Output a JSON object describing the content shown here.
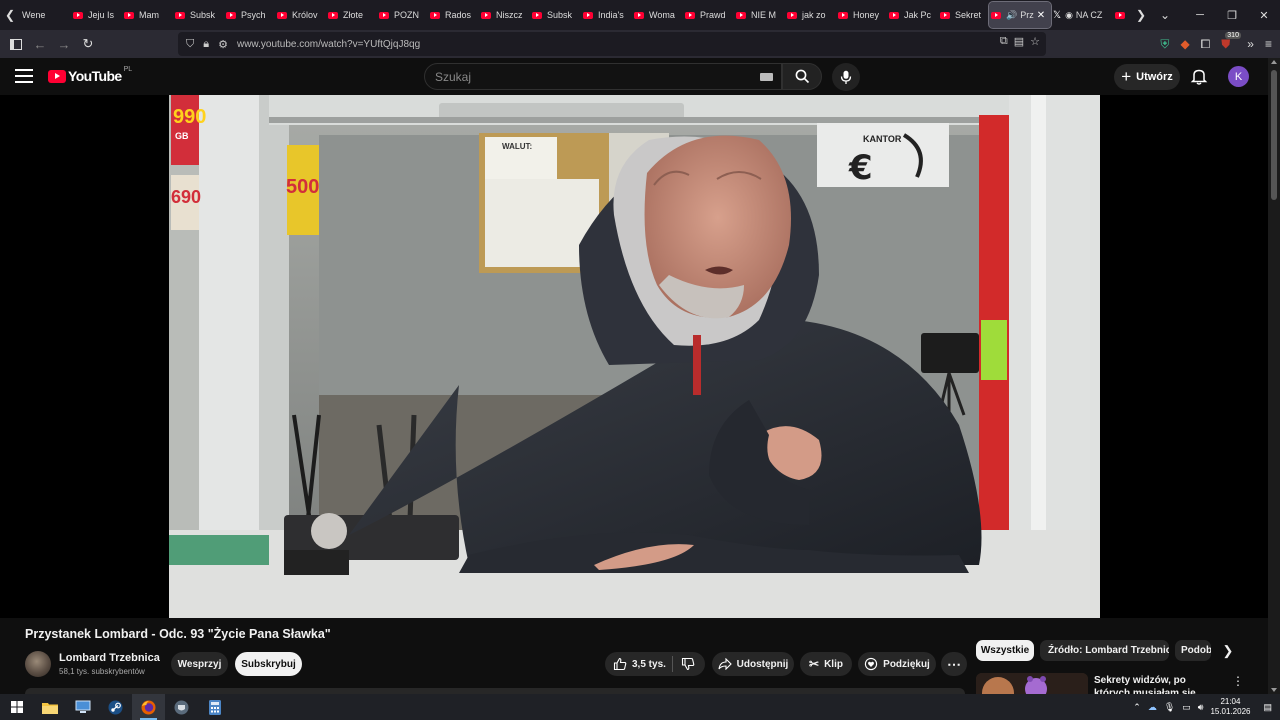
{
  "browser": {
    "tabs": [
      {
        "label": "Wene",
        "favicon": "none"
      },
      {
        "label": "Jeju Is",
        "favicon": "youtube"
      },
      {
        "label": "Mam",
        "favicon": "youtube"
      },
      {
        "label": "Subsk",
        "favicon": "youtube"
      },
      {
        "label": "Psych",
        "favicon": "youtube"
      },
      {
        "label": "Królov",
        "favicon": "youtube"
      },
      {
        "label": "Złote",
        "favicon": "youtube"
      },
      {
        "label": "POZN",
        "favicon": "youtube"
      },
      {
        "label": "Rados",
        "favicon": "youtube"
      },
      {
        "label": "Niszcz",
        "favicon": "youtube"
      },
      {
        "label": "Subsk",
        "favicon": "youtube"
      },
      {
        "label": "India's",
        "favicon": "youtube"
      },
      {
        "label": "Woma",
        "favicon": "youtube"
      },
      {
        "label": "Prawd",
        "favicon": "youtube"
      },
      {
        "label": "NIE M",
        "favicon": "youtube"
      },
      {
        "label": "jak zo",
        "favicon": "youtube"
      },
      {
        "label": "Honey",
        "favicon": "youtube"
      },
      {
        "label": "Jak Pc",
        "favicon": "youtube"
      },
      {
        "label": "Sekret",
        "favicon": "youtube"
      }
    ],
    "active_tab": {
      "label": "Prz",
      "close": "✕"
    },
    "x_tab": {
      "label": "NA CZ"
    },
    "url": "www.youtube.com/watch?v=YUftQjqJ8qg",
    "extension_badge": "310"
  },
  "youtube": {
    "logo_text": "YouTube",
    "country_code": "PL",
    "search_placeholder": "Szukaj",
    "create_label": "Utwórz",
    "avatar_letter": "K",
    "video": {
      "title": "Przystanek Lombard - Odc. 93 \"Życie Pana Sławka\"",
      "channel": "Lombard Trzebnica",
      "subscribers": "58,1 tys. subskrybentów",
      "support_label": "Wesprzyj",
      "subscribe_label": "Subskrybuj",
      "likes": "3,5 tys.",
      "share_label": "Udostępnij",
      "clip_label": "Klip",
      "thanks_label": "Podziękuj",
      "scene_text": {
        "sign_kantor": "KANTOR",
        "board_walut": "WALUT:",
        "price_1": "990",
        "price_1_unit": "GB",
        "price_2": "690",
        "price_3": "500"
      }
    },
    "chips": [
      "Wszystkie",
      "Źródło: Lombard Trzebnica",
      "Podob"
    ],
    "recommendation": {
      "title": "Sekrety widzów, po których musiałam się położyć"
    }
  },
  "taskbar": {
    "time": "21:04",
    "date": "15.01.2026"
  },
  "colors": {
    "youtube_red": "#ff0033",
    "page_bg": "#0f0f0f",
    "avatar_purple": "#7b4dc6"
  }
}
